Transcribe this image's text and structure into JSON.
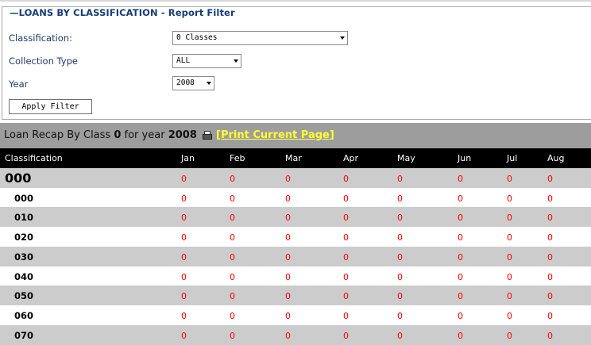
{
  "filter": {
    "legend_title": "LOANS BY CLASSIFICATION - Report Filter",
    "classification_label": "Classification:",
    "classification_value": "0 Classes",
    "collection_type_label": "Collection Type",
    "collection_type_value": "ALL",
    "year_label": "Year",
    "year_value": "2008",
    "apply_button": "Apply Filter"
  },
  "recap": {
    "prefix": "Loan Recap By Class",
    "class_value": "0",
    "middle": "for year",
    "year_value": "2008",
    "print_link": "[Print Current Page]"
  },
  "table": {
    "headers": [
      "Classification",
      "Jan",
      "Feb",
      "Mar",
      "Apr",
      "May",
      "Jun",
      "Jul",
      "Aug"
    ],
    "rows": [
      {
        "label": "000",
        "values": [
          "0",
          "0",
          "0",
          "0",
          "0",
          "0",
          "0",
          "0"
        ]
      },
      {
        "label": "000",
        "values": [
          "0",
          "0",
          "0",
          "0",
          "0",
          "0",
          "0",
          "0"
        ]
      },
      {
        "label": "010",
        "values": [
          "0",
          "0",
          "0",
          "0",
          "0",
          "0",
          "0",
          "0"
        ]
      },
      {
        "label": "020",
        "values": [
          "0",
          "0",
          "0",
          "0",
          "0",
          "0",
          "0",
          "0"
        ]
      },
      {
        "label": "030",
        "values": [
          "0",
          "0",
          "0",
          "0",
          "0",
          "0",
          "0",
          "0"
        ]
      },
      {
        "label": "040",
        "values": [
          "0",
          "0",
          "0",
          "0",
          "0",
          "0",
          "0",
          "0"
        ]
      },
      {
        "label": "050",
        "values": [
          "0",
          "0",
          "0",
          "0",
          "0",
          "0",
          "0",
          "0"
        ]
      },
      {
        "label": "060",
        "values": [
          "0",
          "0",
          "0",
          "0",
          "0",
          "0",
          "0",
          "0"
        ]
      },
      {
        "label": "070",
        "values": [
          "0",
          "0",
          "0",
          "0",
          "0",
          "0",
          "0",
          "0"
        ]
      }
    ]
  },
  "colors": {
    "value_red": "#ff0000",
    "header_black": "#000000",
    "row_gray": "#cccccc",
    "link_yellow": "#ffff33",
    "legend_blue": "#173d78"
  }
}
